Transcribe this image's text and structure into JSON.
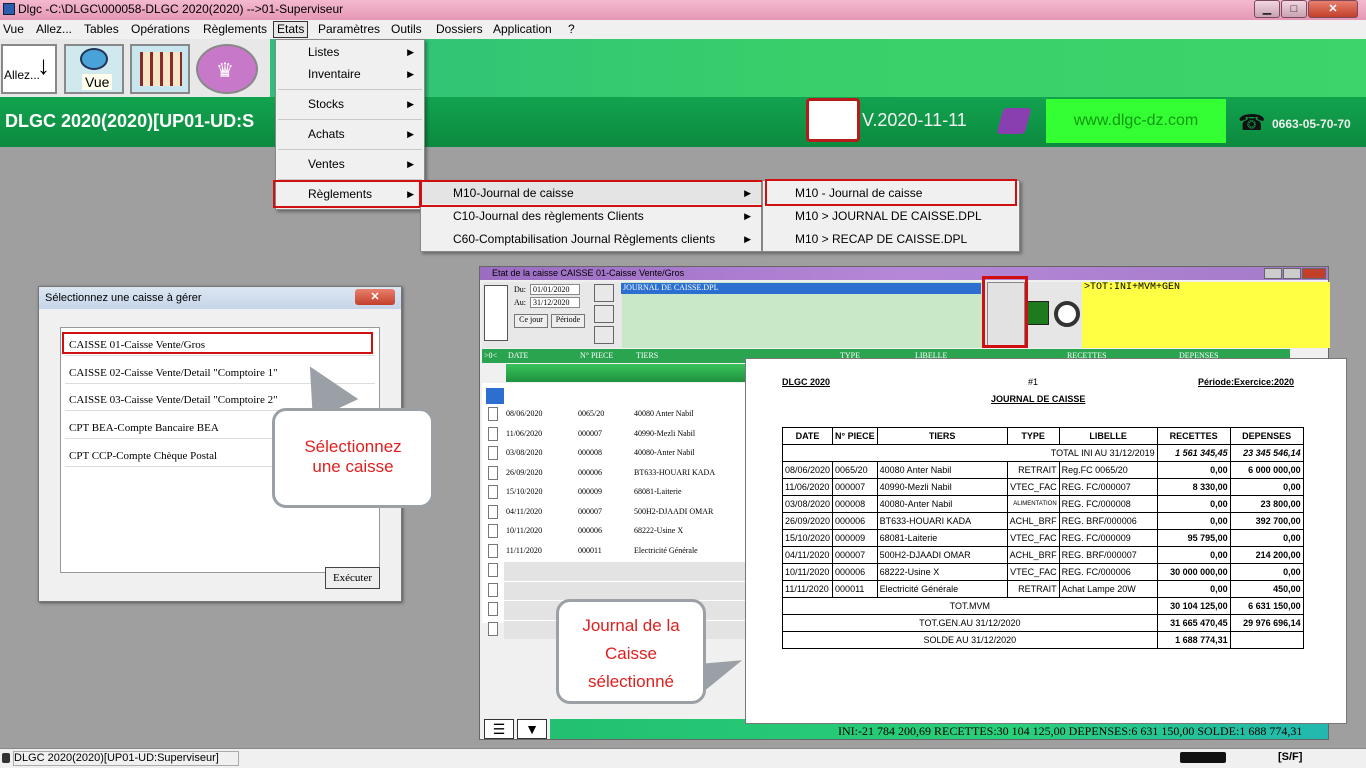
{
  "window": {
    "title": "Dlgc -C:\\DLGC\\000058-DLGC 2020(2020) -->01-Superviseur",
    "min_label": "▁",
    "max_label": "□",
    "close_label": "✕"
  },
  "menubar": [
    "Vue",
    "Allez...",
    "Tables",
    "Opérations",
    "Règlements",
    "Etats",
    "Paramètres",
    "Outils",
    "Dossiers",
    "Application",
    "?"
  ],
  "toolbar": {
    "allez_label": "Allez...",
    "vue_label": "Vue"
  },
  "banner": {
    "app_title": "DLGC 2020(2020)[UP01-UD:S",
    "version": "V.2020-11-11",
    "website": "www.dlgc-dz.com",
    "phone": "0663-05-70-70"
  },
  "etats_menu": [
    "Listes",
    "Inventaire",
    "Stocks",
    "Achats",
    "Ventes",
    "Règlements"
  ],
  "reglements_submenu": [
    "M10-Journal de caisse",
    "C10-Journal des règlements Clients",
    "C60-Comptabilisation Journal Règlements clients"
  ],
  "m10_submenu": [
    "M10 - Journal de caisse",
    "M10 > JOURNAL DE CAISSE.DPL",
    "M10 > RECAP DE CAISSE.DPL"
  ],
  "caisse_dialog": {
    "title": "Sélectionnez une caisse à gérer",
    "close_label": "✕",
    "items": [
      "CAISSE 01-Caisse Vente/Gros",
      "CAISSE 02-Caisse Vente/Detail  \"Comptoire 1\"",
      "CAISSE 03-Caisse Vente/Detail  \"Comptoire 2\"",
      "CPT BEA-Compte Bancaire BEA",
      "CPT CCP-Compte Chèque Postal"
    ],
    "execute_label": "Exécuter"
  },
  "callouts": {
    "select": "Sélectionnez une caisse",
    "journal": "Journal de la Caisse sélectionné"
  },
  "etat_window": {
    "title": "Etat de la caisse CAISSE 01-Caisse Vente/Gros",
    "du_label": "Du:",
    "du_value": "01/01/2020",
    "au_label": "Au:",
    "au_value": "31/12/2020",
    "ce_jour_label": "Ce jour",
    "periode_label": "Période",
    "report_file": "JOURNAL DE CAISSE.DPL",
    "formula": ">TOT:INI+MVM+GEN",
    "columns": [
      ">0<",
      "DATE",
      "N° PIECE",
      "TIERS",
      "TYPE",
      "LIBELLE",
      "RECETTES",
      "DEPENSES"
    ],
    "rows": [
      [
        "08/06/2020",
        "0065/20",
        "40080  Anter Nabil"
      ],
      [
        "11/06/2020",
        "000007",
        "40990-Mezli Nabil"
      ],
      [
        "03/08/2020",
        "000008",
        "40080-Anter Nabil"
      ],
      [
        "26/09/2020",
        "000006",
        "BT633-HOUARI KADA"
      ],
      [
        "15/10/2020",
        "000009",
        "68081-Laiterie"
      ],
      [
        "04/11/2020",
        "000007",
        "500H2-DJAADI OMAR"
      ],
      [
        "10/11/2020",
        "000006",
        "68222-Usine X"
      ],
      [
        "11/11/2020",
        "000011",
        "Electricité Générale"
      ]
    ],
    "totals_line": "INI:-21 784 200,69  RECETTES:30 104 125,00  DEPENSES:6 631 150,00  SOLDE:1 688 774,31"
  },
  "report": {
    "company": "DLGC 2020",
    "number": "#1",
    "period": "Période:Exercice:2020",
    "title": "JOURNAL DE CAISSE",
    "headers": [
      "DATE",
      "N° PIECE",
      "TIERS",
      "TYPE",
      "LIBELLE",
      "RECETTES",
      "DEPENSES"
    ],
    "total_ini": {
      "label": "TOTAL INI AU 31/12/2019",
      "recettes": "1 561 345,45",
      "depenses": "23 345 546,14"
    },
    "rows": [
      [
        "08/06/2020",
        "0065/20",
        "40080  Anter Nabil",
        "RETRAIT",
        "Reg.FC 0065/20",
        "0,00",
        "6 000 000,00"
      ],
      [
        "11/06/2020",
        "000007",
        "40990-Mezli Nabil",
        "VTEC_FAC",
        "REG. FC/000007",
        "8 330,00",
        "0,00"
      ],
      [
        "03/08/2020",
        "000008",
        "40080-Anter Nabil",
        "ALIMENTATION",
        "REG. FC/000008",
        "0,00",
        "23 800,00"
      ],
      [
        "26/09/2020",
        "000006",
        "BT633-HOUARI KADA",
        "ACHL_BRF",
        "REG. BRF/000006",
        "0,00",
        "392 700,00"
      ],
      [
        "15/10/2020",
        "000009",
        "68081-Laiterie",
        "VTEC_FAC",
        "REG. FC/000009",
        "95 795,00",
        "0,00"
      ],
      [
        "04/11/2020",
        "000007",
        "500H2-DJAADI OMAR",
        "ACHL_BRF",
        "REG. BRF/000007",
        "0,00",
        "214 200,00"
      ],
      [
        "10/11/2020",
        "000006",
        "68222-Usine X",
        "VTEC_FAC",
        "REG. FC/000006",
        "30 000 000,00",
        "0,00"
      ],
      [
        "11/11/2020",
        "000011",
        "Electricité Générale",
        "RETRAIT",
        "Achat Lampe 20W",
        "0,00",
        "450,00"
      ]
    ],
    "tot_mvm": {
      "label": "TOT.MVM",
      "recettes": "30 104 125,00",
      "depenses": "6 631 150,00"
    },
    "tot_gen": {
      "label": "TOT.GEN.AU 31/12/2020",
      "recettes": "31 665 470,45",
      "depenses": "29 976 696,14"
    },
    "solde": {
      "label": "SOLDE AU 31/12/2020",
      "value": "1 688 774,31"
    }
  },
  "statusbar": {
    "left": "DLGC 2020(2020)[UP01-UD:Superviseur]",
    "right": "[S/F]"
  }
}
